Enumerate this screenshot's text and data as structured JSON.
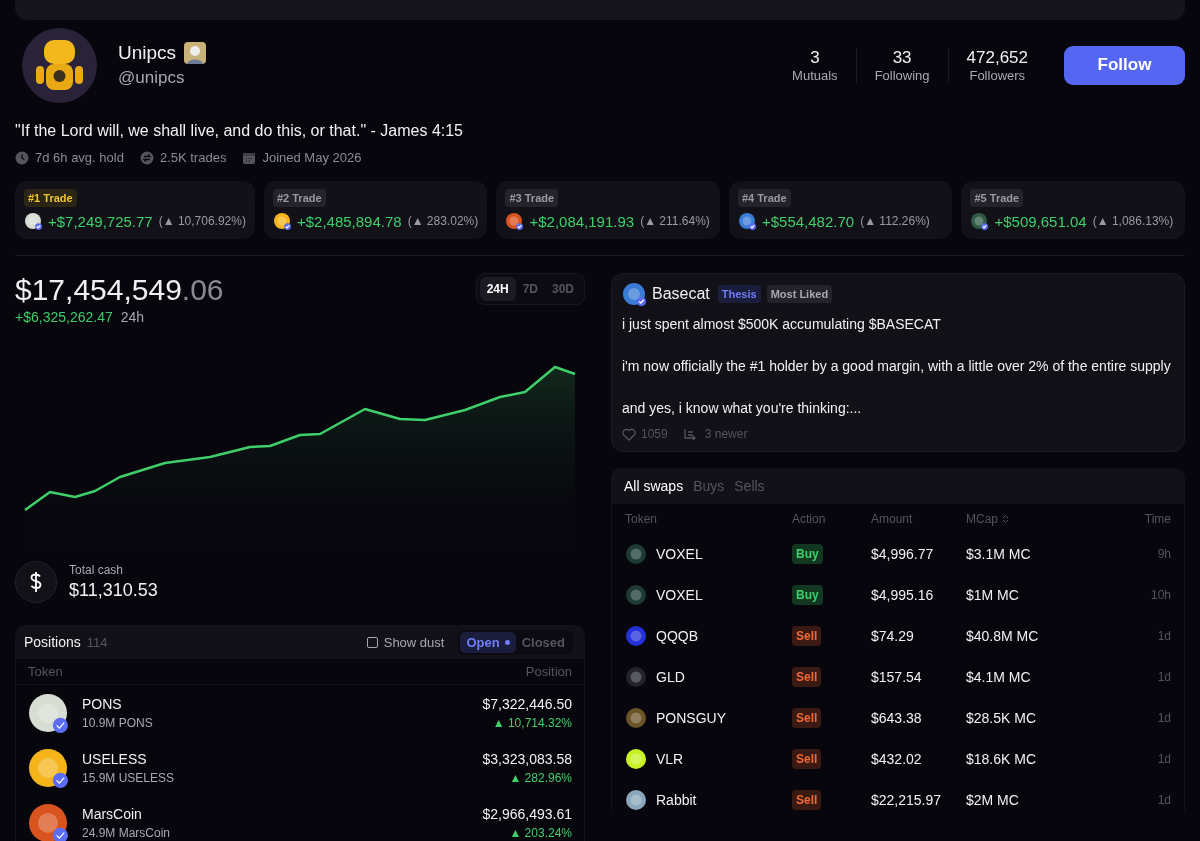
{
  "profile": {
    "name": "Unipcs",
    "handle": "@unipcs",
    "bio": "\"If the Lord will, we shall live, and do this, or that.\" - James 4:15",
    "meta": [
      {
        "kind": "hold",
        "text": "7d 6h avg. hold"
      },
      {
        "kind": "trades",
        "text": "2.5K trades"
      },
      {
        "kind": "joined",
        "text": "Joined May 2026"
      }
    ],
    "stats": [
      {
        "value": "3",
        "label": "Mutuals"
      },
      {
        "value": "33",
        "label": "Following"
      },
      {
        "value": "472,652",
        "label": "Followers"
      }
    ],
    "follow_button": "Follow"
  },
  "top_trades": [
    {
      "rank": "#1 Trade",
      "highlighted": true,
      "gain": "+$7,249,725.77",
      "pct": "(▲ 10,706.92%)"
    },
    {
      "rank": "#2 Trade",
      "highlighted": false,
      "gain": "+$2,485,894.78",
      "pct": "(▲ 283.02%)"
    },
    {
      "rank": "#3 Trade",
      "highlighted": false,
      "gain": "+$2,084,191.93",
      "pct": "(▲ 211.64%)"
    },
    {
      "rank": "#4 Trade",
      "highlighted": false,
      "gain": "+$554,482.70",
      "pct": "(▲ 112.26%)"
    },
    {
      "rank": "#5 Trade",
      "highlighted": false,
      "gain": "+$509,651.04",
      "pct": "(▲ 1,086.13%)"
    }
  ],
  "portfolio": {
    "value": "$17,454,549",
    "cents": ".06",
    "change": "+$6,325,262.47",
    "period": "24h",
    "ranges": [
      {
        "label": "24H",
        "selected": true
      },
      {
        "label": "7D",
        "selected": false
      },
      {
        "label": "30D",
        "selected": false
      }
    ],
    "cash_label": "Total cash",
    "cash": "$11,310.53"
  },
  "positions": {
    "title": "Positions",
    "count": "114",
    "show_dust": {
      "label": "Show dust",
      "checked": false
    },
    "filters": [
      {
        "label": "Open",
        "selected": true
      },
      {
        "label": "Closed",
        "selected": false
      }
    ],
    "columns": [
      "Token",
      "Position"
    ],
    "rows": [
      {
        "name": "PONS",
        "amount": "10.9M PONS",
        "value": "$7,322,446.50",
        "pct": "▲ 10,714.32%"
      },
      {
        "name": "USELESS",
        "amount": "15.9M USELESS",
        "value": "$3,323,083.58",
        "pct": "▲ 282.96%"
      },
      {
        "name": "MarsCoin",
        "amount": "24.9M MarsCoin",
        "value": "$2,966,493.61",
        "pct": "▲ 203.24%"
      }
    ]
  },
  "post": {
    "author": "Basecat",
    "tags": [
      {
        "kind": "thesis",
        "label": "Thesis"
      },
      {
        "kind": "most_liked",
        "label": "Most Liked"
      }
    ],
    "paragraphs": [
      "i just spent almost $500K accumulating $BASECAT",
      "i'm now officially the #1 holder by a good margin, with a little over 2% of the entire supply",
      "and yes, i know what you're thinking:..."
    ],
    "likes": "1059",
    "replies": "3 newer"
  },
  "swaps": {
    "tabs": [
      {
        "label": "All swaps",
        "selected": true
      },
      {
        "label": "Buys",
        "selected": false
      },
      {
        "label": "Sells",
        "selected": false
      }
    ],
    "columns": [
      "Token",
      "Action",
      "Amount",
      "MCap",
      "Time"
    ],
    "rows": [
      {
        "token": "VOXEL",
        "action": "Buy",
        "kind": "buy",
        "amount": "$4,996.77",
        "mcap": "$3.1M MC",
        "time": "9h"
      },
      {
        "token": "VOXEL",
        "action": "Buy",
        "kind": "buy",
        "amount": "$4,995.16",
        "mcap": "$1M MC",
        "time": "10h"
      },
      {
        "token": "QQQB",
        "action": "Sell",
        "kind": "sell",
        "amount": "$74.29",
        "mcap": "$40.8M MC",
        "time": "1d"
      },
      {
        "token": "GLD",
        "action": "Sell",
        "kind": "sell",
        "amount": "$157.54",
        "mcap": "$4.1M MC",
        "time": "1d"
      },
      {
        "token": "PONSGUY",
        "action": "Sell",
        "kind": "sell",
        "amount": "$643.38",
        "mcap": "$28.5K MC",
        "time": "1d"
      },
      {
        "token": "VLR",
        "action": "Sell",
        "kind": "sell",
        "amount": "$432.02",
        "mcap": "$18.6K MC",
        "time": "1d"
      },
      {
        "token": "Rabbit",
        "action": "Sell",
        "kind": "sell",
        "amount": "$22,215.97",
        "mcap": "$2M MC",
        "time": "1d"
      }
    ]
  }
}
